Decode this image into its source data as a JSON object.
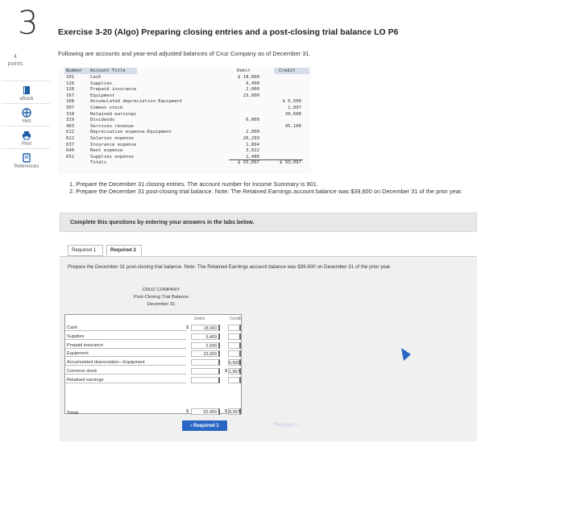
{
  "question": {
    "number": "3",
    "points_value": "4",
    "points_label": "points"
  },
  "rail": {
    "items": [
      {
        "label": "eBook",
        "icon": "book-icon"
      },
      {
        "label": "Hint",
        "icon": "hint-icon"
      },
      {
        "label": "Print",
        "icon": "print-icon"
      },
      {
        "label": "References",
        "icon": "references-icon"
      }
    ]
  },
  "header": {
    "title": "Exercise 3-20 (Algo) Preparing closing entries and a post-closing trial balance LO P6",
    "intro": "Following are accounts and year-end adjusted balances of Cruz Company as of December 31."
  },
  "accounts": {
    "headers": {
      "number": "Number",
      "title": "Account Title",
      "debit": "Debit",
      "credit": "Credit"
    },
    "rows": [
      {
        "number": "101",
        "title": "Cash",
        "debit": "$ 18,000",
        "credit": ""
      },
      {
        "number": "126",
        "title": "Supplies",
        "debit": "9,400",
        "credit": ""
      },
      {
        "number": "128",
        "title": "Prepaid insurance",
        "debit": "2,000",
        "credit": ""
      },
      {
        "number": "167",
        "title": "Equipment",
        "debit": "23,000",
        "credit": ""
      },
      {
        "number": "168",
        "title": "Accumulated depreciation-Equipment",
        "debit": "",
        "credit": "$ 6,500"
      },
      {
        "number": "307",
        "title": "Common stock",
        "debit": "",
        "credit": "1,897"
      },
      {
        "number": "318",
        "title": "Retained earnings",
        "debit": "",
        "credit": "39,600"
      },
      {
        "number": "319",
        "title": "Dividends",
        "debit": "6,000",
        "credit": ""
      },
      {
        "number": "403",
        "title": "Services revenue",
        "debit": "",
        "credit": "45,100"
      },
      {
        "number": "612",
        "title": "Depreciation expense-Equipment",
        "debit": "2,000",
        "credit": ""
      },
      {
        "number": "622",
        "title": "Salaries expense",
        "debit": "26,293",
        "credit": ""
      },
      {
        "number": "637",
        "title": "Insurance expense",
        "debit": "1,894",
        "credit": ""
      },
      {
        "number": "640",
        "title": "Rent expense",
        "debit": "3,022",
        "credit": ""
      },
      {
        "number": "652",
        "title": "Supplies expense",
        "debit": "1,488",
        "credit": ""
      },
      {
        "number": "",
        "title": "Totals",
        "debit": "$ 93,097",
        "credit": "$ 93,097"
      }
    ]
  },
  "requirements": {
    "r1": "1. Prepare the December 31 closing entries. The account number for Income Summary is 901.",
    "r2": "2. Prepare the December 31 post-closing trial balance. Note: The Retained Earnings account balance was $39,600 on December 31 of the prior year."
  },
  "complete_banner": "Complete this questions by entering your answers in the tabs below.",
  "tabs": [
    "Required 1",
    "Required 2"
  ],
  "active_tab": "Required 2",
  "prompt": "Prepare the December 31 post-closing trial balance. Note: The Retained Earnings account balance was $39,600 on December 31 of the prior year.",
  "trial_balance": {
    "company": "CRUZ COMPANY",
    "title": "Post-Closing Trial Balance",
    "date": "December 31",
    "debit_header": "Debit",
    "credit_header": "Credit",
    "currency": "$",
    "rows": [
      {
        "account": "Cash",
        "debit": "18,000",
        "credit": ""
      },
      {
        "account": "Supplies",
        "debit": "9,400",
        "credit": ""
      },
      {
        "account": "Prepaid insurance",
        "debit": "2,000",
        "credit": ""
      },
      {
        "account": "Equipment",
        "debit": "23,000",
        "credit": ""
      },
      {
        "account": "Accumulated depreciation—Equipment",
        "debit": "",
        "credit": "6,500"
      },
      {
        "account": "Common stock",
        "debit": "",
        "credit": "1,897"
      },
      {
        "account": "Retained earnings",
        "debit": "",
        "credit": ""
      }
    ],
    "totals_label": "Totals",
    "total_debit": "52,400",
    "total_credit": "8,397"
  },
  "nav": {
    "prev_label": "Required 1",
    "next_label": "Required 2"
  },
  "colors": {
    "accent": "#2a66c4",
    "banner": "#e8e8e8"
  }
}
